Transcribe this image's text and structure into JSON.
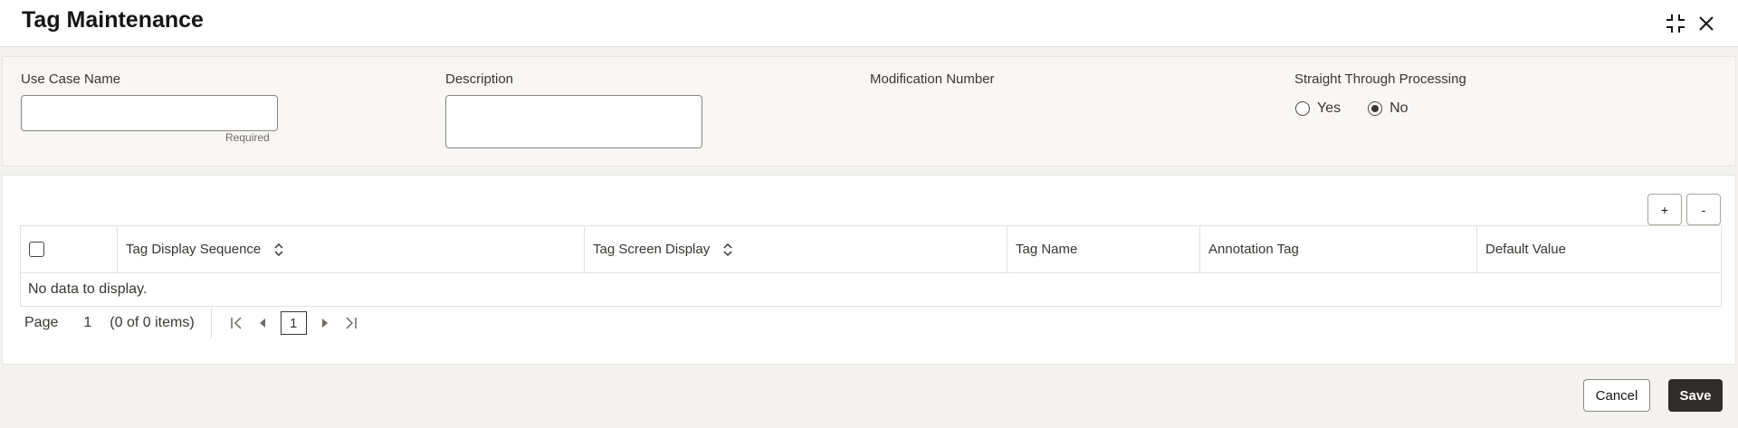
{
  "window": {
    "title": "Tag Maintenance",
    "icons": {
      "collapse": "collapse-icon",
      "close": "close-icon"
    }
  },
  "form": {
    "use_case_name": {
      "label": "Use Case Name",
      "value": "",
      "hint": "Required"
    },
    "description": {
      "label": "Description",
      "value": ""
    },
    "modification_number": {
      "label": "Modification Number",
      "value": ""
    },
    "stp": {
      "label": "Straight Through Processing",
      "options": [
        {
          "label": "Yes",
          "selected": false
        },
        {
          "label": "No",
          "selected": true
        }
      ]
    }
  },
  "grid": {
    "add_label": "+",
    "remove_label": "-",
    "columns": [
      {
        "label": "",
        "sortable": false
      },
      {
        "label": "Tag Display Sequence",
        "sortable": true
      },
      {
        "label": "Tag Screen Display",
        "sortable": true
      },
      {
        "label": "Tag Name",
        "sortable": false
      },
      {
        "label": "Annotation Tag",
        "sortable": false
      },
      {
        "label": "Default Value",
        "sortable": false
      }
    ],
    "empty_text": "No data to display.",
    "pager": {
      "page_label": "Page",
      "page": "1",
      "items_text": "(0 of 0 items)",
      "current": "1"
    }
  },
  "footer": {
    "cancel_label": "Cancel",
    "save_label": "Save"
  },
  "colors": {
    "primary_button": "#312d2a",
    "background": "#f3f2ef",
    "panel": "#f8f7f5"
  }
}
